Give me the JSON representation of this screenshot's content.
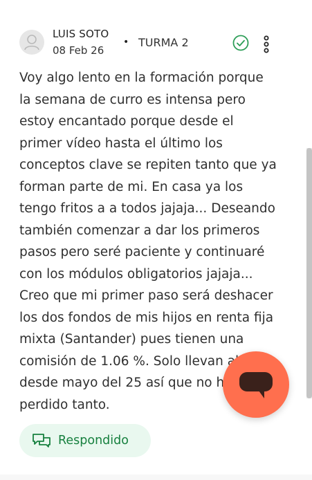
{
  "post": {
    "author": "LUIS SOTO",
    "date": "08 Feb 26",
    "separator": "•",
    "group": "TURMA 2",
    "body": "Voy algo lento en la formación porque la semana de curro es intensa pero estoy encantado porque desde el primer vídeo hasta el último los conceptos clave se repiten tanto que ya forman parte de mi. En casa ya los tengo fritos a a todos jajaja... Deseando también comenzar a dar los primeros pasos pero seré paciente y continuaré con los módulos obligatorios jajaja... Creo que mi primer paso será deshacer los dos fondos de mis hijos en renta fija mixta (Santander) pues tienen una comisión de 1.06 %. Solo llevan algo desde mayo del 25 así que no habrán perdido tanto.",
    "status_label": "Respondido"
  },
  "icons": {
    "avatar": "user-avatar-icon",
    "check": "check-circle-icon",
    "menu": "kebab-menu-icon",
    "responded": "chat-bubbles-icon",
    "fab": "chat-bubble-icon"
  },
  "colors": {
    "accent_green": "#2e9e58",
    "badge_bg": "#e9f8ef",
    "badge_text": "#17803f",
    "fab_bg": "#ff6f4e",
    "fab_icon": "#3a211b"
  }
}
